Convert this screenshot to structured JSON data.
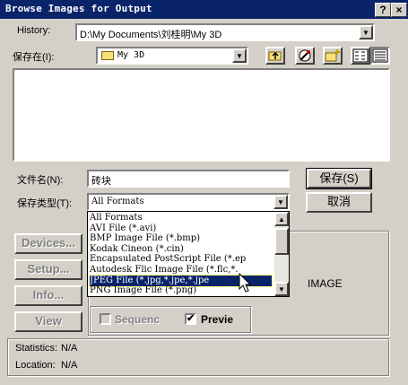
{
  "window": {
    "title": "Browse Images for Output",
    "help_glyph": "?",
    "close_glyph": "×"
  },
  "history": {
    "label": "History:",
    "value": "D:\\My Documents\\刘桂明\\My 3D"
  },
  "save_in": {
    "label": "保存在(I):",
    "value": "My 3D"
  },
  "filename": {
    "label": "文件名(N):",
    "value": "砖块"
  },
  "filetype": {
    "label": "保存类型(T):",
    "value": "All Formats"
  },
  "buttons": {
    "save": "保存(S)",
    "cancel": "取消",
    "devices": "Devices...",
    "setup": "Setup...",
    "info": "Info...",
    "view": "View"
  },
  "dropdown_items": [
    "All Formats",
    "AVI File (*.avi)",
    "BMP Image File (*.bmp)",
    "Kodak Cineon (*.cin)",
    "Encapsulated PostScript File (*.ep",
    "Autodesk Flic Image File (*.flc,*.",
    "JPEG File (*.jpg,*.jpe,*.jpe",
    "PNG Image File (*.png)"
  ],
  "selected_index": 6,
  "options": {
    "sequence": "Sequenc",
    "preview": "Previe"
  },
  "preview_text": "IMAGE",
  "stats": {
    "statistics_label": "Statistics:",
    "statistics_value": "N/A",
    "location_label": "Location:",
    "location_value": "N/A"
  },
  "icons": {
    "arrow_down": "▼",
    "arrow_up": "▲",
    "check": "✔"
  }
}
